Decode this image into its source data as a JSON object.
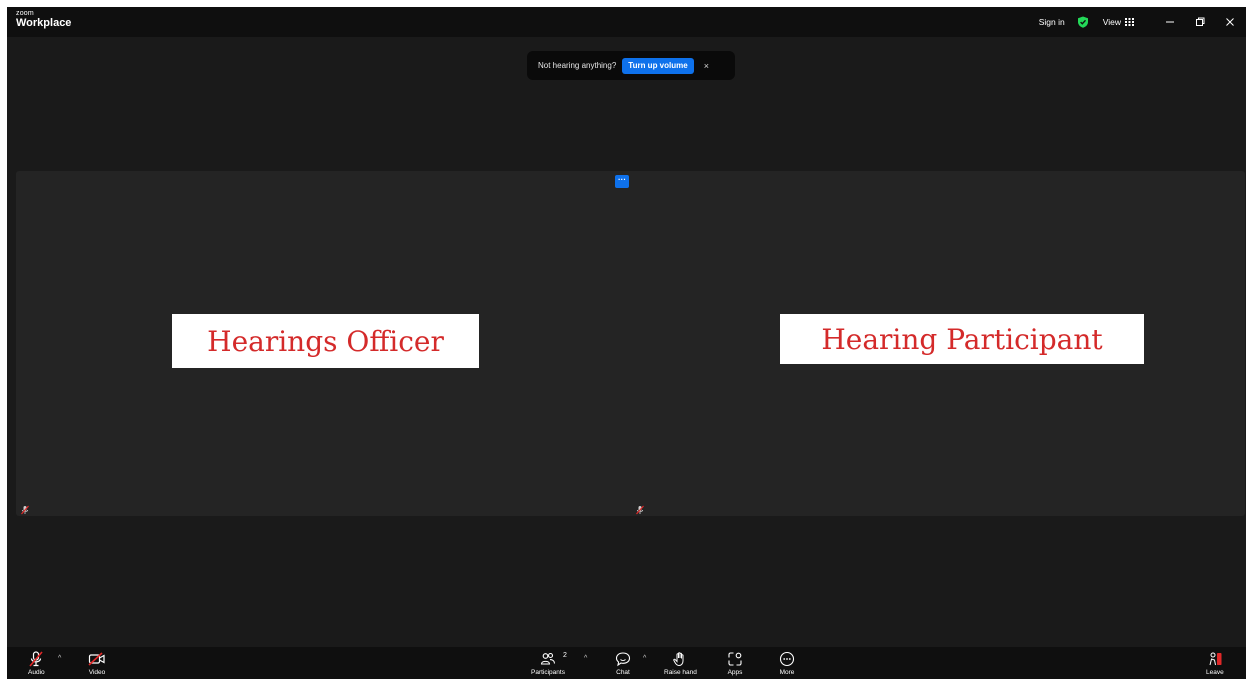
{
  "titlebar": {
    "brand_small": "zoom",
    "brand_big": "Workplace",
    "sign_in": "Sign in",
    "view": "View"
  },
  "notification": {
    "text": "Not hearing anything?",
    "button": "Turn up volume",
    "close": "×"
  },
  "gallery": {
    "menu_glyph": "···",
    "tiles": [
      {
        "name": "Hearings Officer",
        "audio": "muted"
      },
      {
        "name": "Hearing Participant",
        "audio": "muted"
      }
    ]
  },
  "toolbar": {
    "audio": "Audio",
    "video": "Video",
    "participants": "Participants",
    "participants_count": "2",
    "chat": "Chat",
    "raise_hand": "Raise hand",
    "apps": "Apps",
    "more": "More",
    "leave": "Leave"
  },
  "colors": {
    "accent": "#0e71eb",
    "leave": "#e02828",
    "shield": "#23d959",
    "name_text": "#d42a2a"
  }
}
